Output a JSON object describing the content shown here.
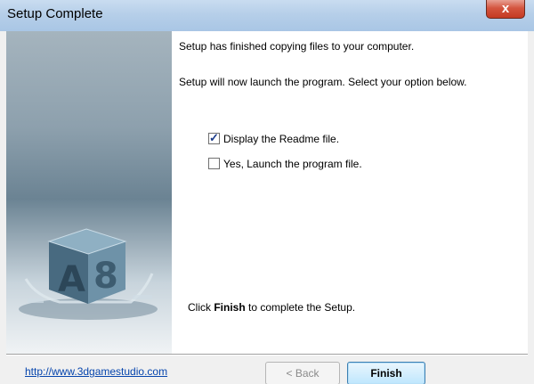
{
  "window": {
    "title": "Setup Complete",
    "close_label": "x"
  },
  "body": {
    "line1": "Setup has finished copying files to your computer.",
    "line2": "Setup will now launch the program. Select your option below.",
    "options": [
      {
        "label": "Display the Readme file.",
        "checked": true
      },
      {
        "label": "Yes, Launch the program file.",
        "checked": false
      }
    ],
    "finish_pre": "Click ",
    "finish_bold": "Finish",
    "finish_post": " to complete the Setup."
  },
  "footer": {
    "link": "http://www.3dgamestudio.com",
    "back_button": "< Back",
    "finish_button": "Finish"
  },
  "side_image": {
    "logo_text": "A8"
  }
}
